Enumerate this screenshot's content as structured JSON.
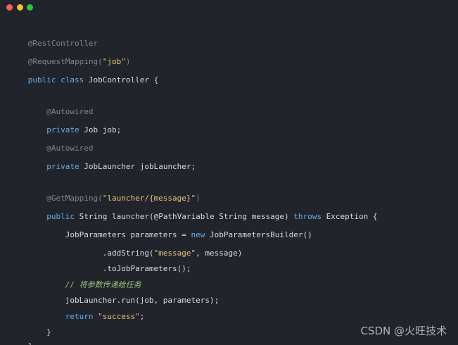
{
  "window": {
    "controls": [
      "close",
      "minimize",
      "maximize"
    ],
    "colors": {
      "close": "#fe5f57",
      "minimize": "#febc2e",
      "maximize": "#28c840"
    }
  },
  "code": {
    "l01_a": "@RestController",
    "l02_a": "@RequestMapping(",
    "l02_b": "\"job\"",
    "l02_c": ")",
    "l03_a": "public class",
    "l03_b": " JobController {",
    "l04_a": "    @Autowired",
    "l05_a": "    private",
    "l05_b": " Job job;",
    "l06_a": "    @Autowired",
    "l07_a": "    private",
    "l07_b": " JobLauncher jobLauncher;",
    "l08_a": "    @GetMapping(",
    "l08_b": "\"launcher/{message}\"",
    "l08_c": ")",
    "l09_a": "    public",
    "l09_b": " String launcher(@PathVariable String message) ",
    "l09_c": "throws",
    "l09_d": " Exception {",
    "l10_a": "        JobParameters parameters = ",
    "l10_b": "new",
    "l10_c": " JobParametersBuilder()",
    "l11_a": "                .addString(",
    "l11_b": "\"message\"",
    "l11_c": ", message)",
    "l12_a": "                .toJobParameters();",
    "l13_a": "        // 将参数传递给任务",
    "l14_a": "        jobLauncher.run(job, parameters);",
    "l15_a": "        return ",
    "l15_b": "\"success\"",
    "l15_c": ";",
    "l16_a": "    }",
    "l17_a": "}"
  },
  "watermark": "CSDN @火旺技术",
  "theme": {
    "background": "#21252b",
    "annotation": "#7f848e",
    "keyword": "#61afef",
    "string": "#e5c07b",
    "comment": "#98c379",
    "text": "#d7dae0"
  }
}
